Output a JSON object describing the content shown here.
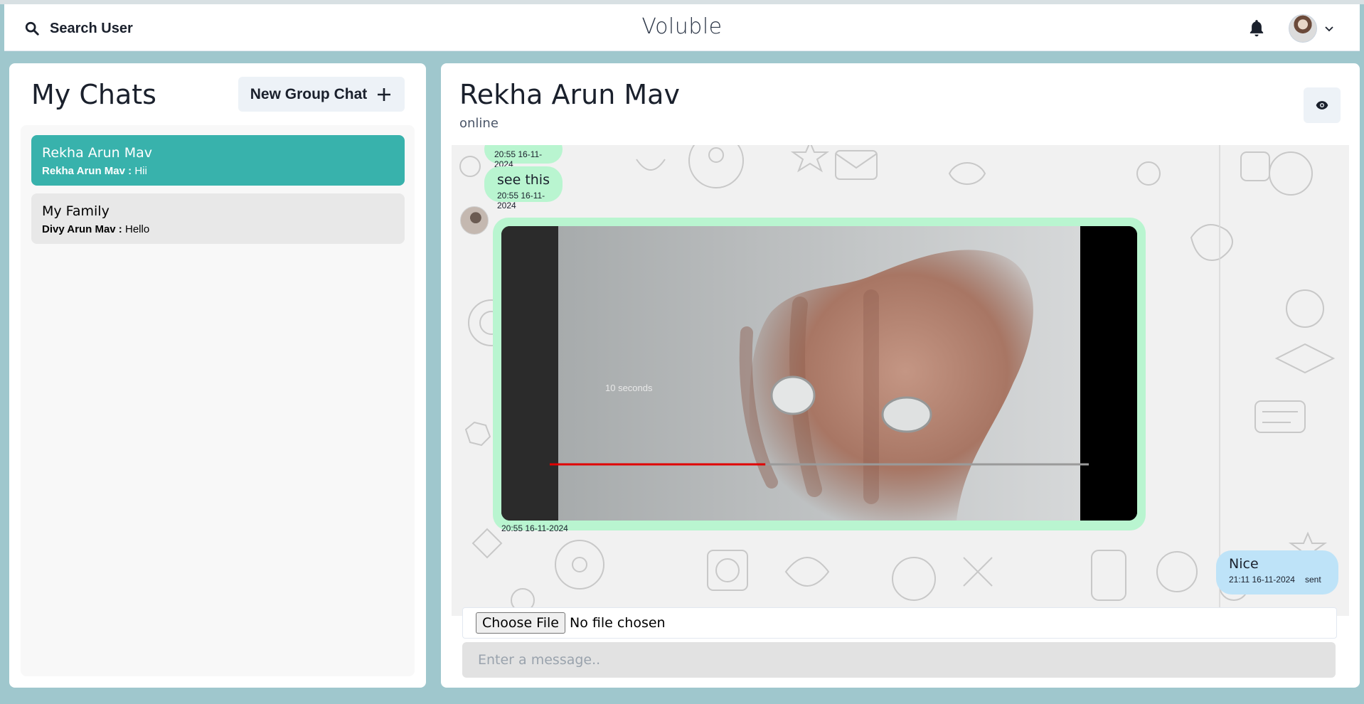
{
  "app": {
    "brand": "Voluble"
  },
  "header": {
    "search_label": "Search User",
    "search_icon": "search-icon",
    "bell_icon": "bell-icon",
    "profile_chevron_icon": "chevron-down-icon"
  },
  "sidebar": {
    "title": "My Chats",
    "new_group_label": "New Group Chat",
    "chats": [
      {
        "name": "Rekha Arun Mav",
        "last_sender": "Rekha Arun Mav :",
        "last_message": "Hii",
        "active": true
      },
      {
        "name": "My Family",
        "last_sender": "Divy Arun Mav :",
        "last_message": "Hello",
        "active": false
      }
    ]
  },
  "chat": {
    "contact_name": "Rekha Arun Mav",
    "status": "online",
    "messages": [
      {
        "text": "",
        "time": "20:55 16-11-2024",
        "direction": "received"
      },
      {
        "text": "see this",
        "time": "20:55 16-11-2024",
        "direction": "received"
      },
      {
        "type": "video",
        "caption": "10 seconds",
        "time": "20:55 16-11-2024",
        "direction": "received",
        "progress": 0.4
      },
      {
        "text": "Nice",
        "time": "21:11 16-11-2024",
        "status": "sent",
        "direction": "sent"
      }
    ],
    "file_button": "Choose File",
    "file_status": "No file chosen",
    "input_placeholder": "Enter a message.."
  },
  "colors": {
    "background": "#9fc7cd",
    "accent": "#38b2ac",
    "received_bubble": "#b9f5d0",
    "sent_bubble": "#bee3f8"
  }
}
